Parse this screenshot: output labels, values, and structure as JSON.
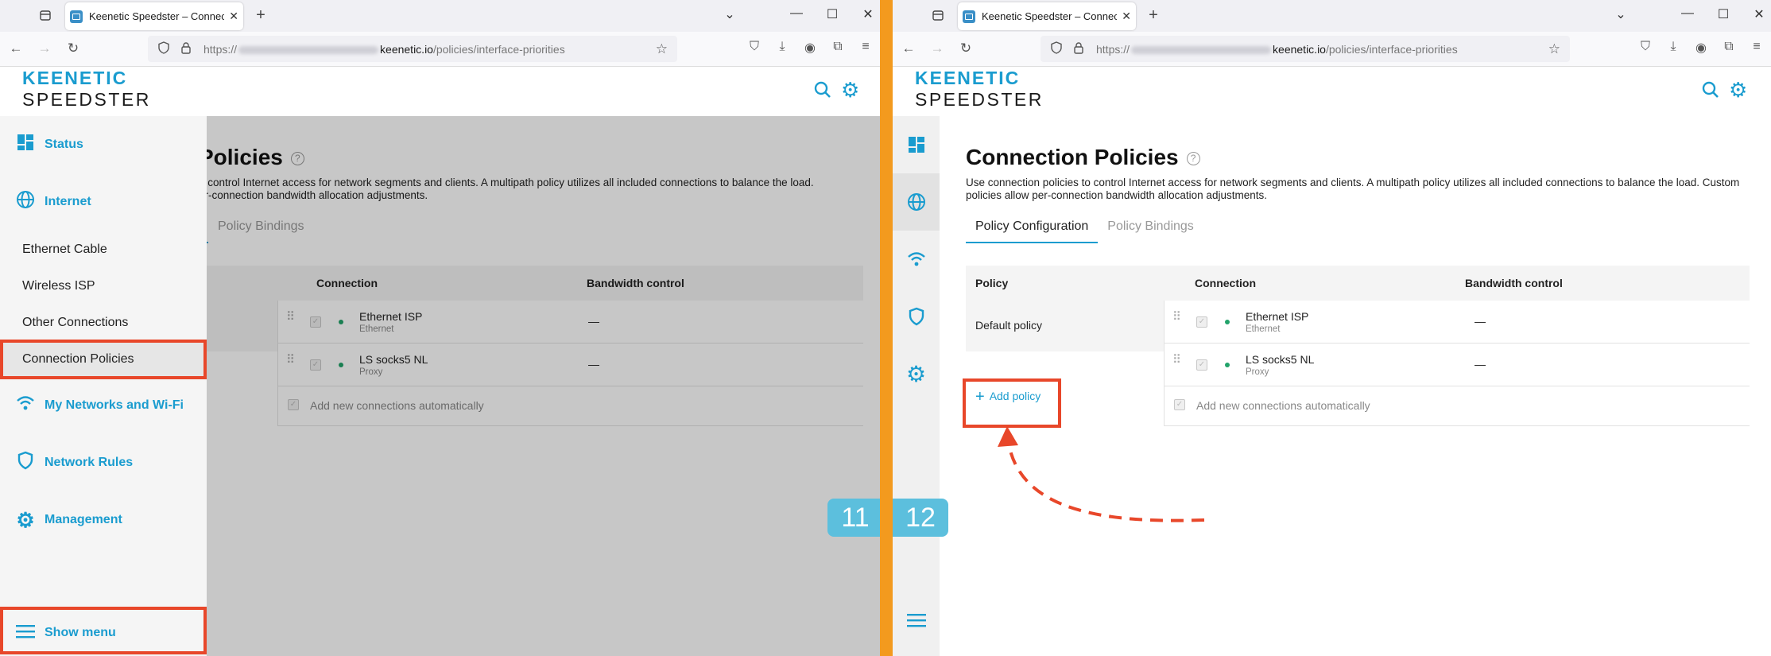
{
  "browser": {
    "tab_title": "Keenetic Speedster – Connection Policies",
    "tab_close": "✕",
    "new_tab": "+",
    "url_prefix": "https://",
    "url_domain": "keenetic.io",
    "url_path": "/policies/interface-priorities"
  },
  "app": {
    "logo_line1": "KEENETIC",
    "logo_line2": "SPEEDSTER"
  },
  "page": {
    "title": "Connection Policies",
    "title_partial": "Policies",
    "description": "Use connection policies to control Internet access for network segments and clients. A multipath policy utilizes all included connections to balance the load. Custom policies allow per-connection bandwidth allocation adjustments.",
    "desc_partial_line1": "o control Internet access for network segments and clients. A multipath policy utilizes all included connections to balance the load.",
    "desc_partial_line2": "er-connection bandwidth allocation adjustments.",
    "tabs": [
      "Policy Configuration",
      "Policy Bindings"
    ],
    "columns": {
      "policy": "Policy",
      "connection": "Connection",
      "bandwidth": "Bandwidth control"
    },
    "default_policy": "Default policy",
    "add_policy": "Add policy",
    "connections": [
      {
        "name": "Ethernet ISP",
        "type": "Ethernet",
        "bandwidth": "—"
      },
      {
        "name": "LS socks5 NL",
        "type": "Proxy",
        "bandwidth": "—"
      }
    ],
    "add_auto": "Add new connections automatically"
  },
  "sidebar": {
    "status": "Status",
    "internet": "Internet",
    "sub": [
      "Ethernet Cable",
      "Wireless ISP",
      "Other Connections",
      "Connection Policies"
    ],
    "my_networks": "My Networks and Wi-Fi",
    "network_rules": "Network Rules",
    "management": "Management",
    "show_menu": "Show menu"
  },
  "steps": {
    "left": "11",
    "right": "12"
  },
  "colors": {
    "accent": "#1a9ccf",
    "highlight": "#e8472a",
    "divider": "#f39a1e",
    "step_badge": "#5cbfdd"
  },
  "icons": [
    "tab-overview-icon",
    "back-icon",
    "forward-icon",
    "reload-icon",
    "shield-icon",
    "lock-icon",
    "star-icon",
    "pocket-icon",
    "download-icon",
    "account-icon",
    "extensions-icon",
    "menu-icon",
    "search-icon",
    "gear-icon",
    "dashboard-icon",
    "globe-icon",
    "wifi-icon",
    "network-shield-icon",
    "management-gear-icon",
    "hamburger-icon"
  ]
}
